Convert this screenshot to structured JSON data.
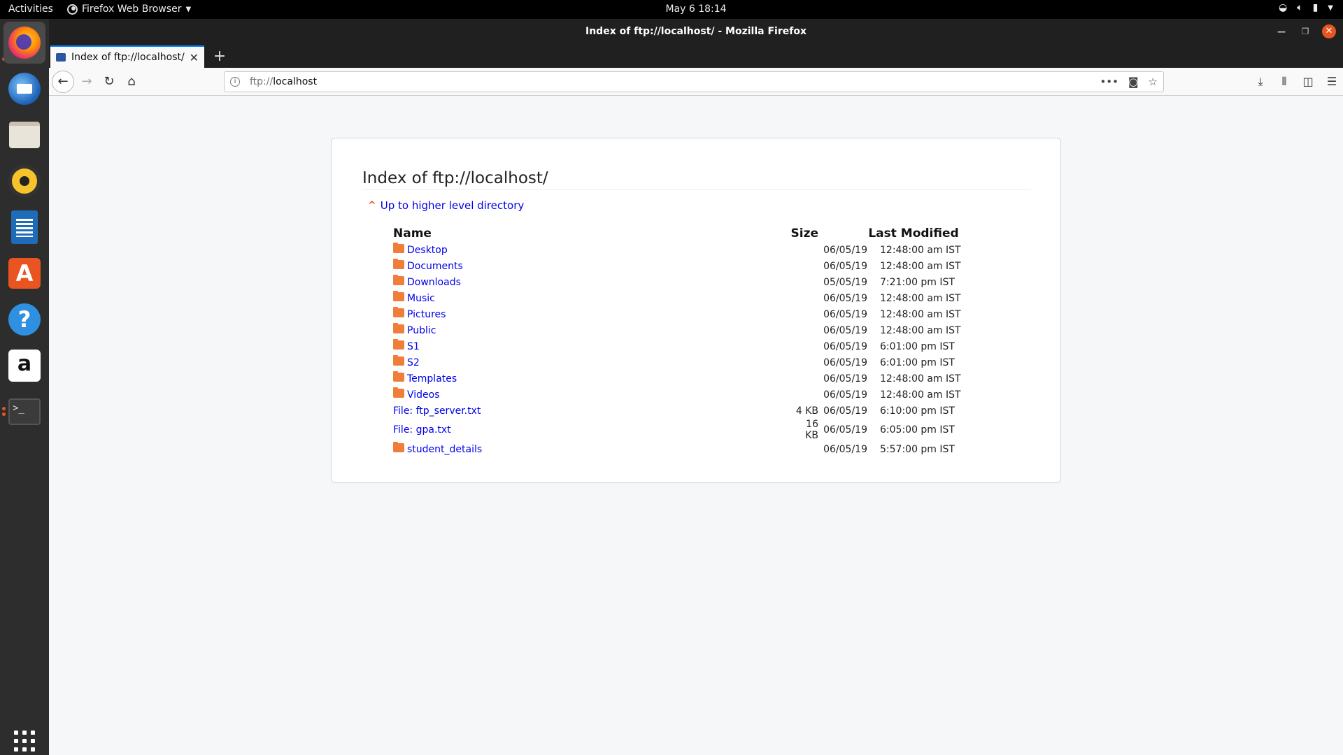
{
  "topbar": {
    "activities": "Activities",
    "app_menu": "Firefox Web Browser",
    "clock": "May 6  18:14"
  },
  "window": {
    "title": "Index of ftp://localhost/ - Mozilla Firefox"
  },
  "tab": {
    "title": "Index of ftp://localhost/"
  },
  "urlbar": {
    "scheme": "ftp://",
    "host": "localhost"
  },
  "page": {
    "heading": "Index of ftp://localhost/",
    "up_link": "Up to higher level directory",
    "columns": {
      "name": "Name",
      "size": "Size",
      "modified": "Last Modified"
    },
    "entries": [
      {
        "name": "Desktop",
        "size": "",
        "date": "06/05/19",
        "time": "12:48:00 am IST"
      },
      {
        "name": "Documents",
        "size": "",
        "date": "06/05/19",
        "time": "12:48:00 am IST"
      },
      {
        "name": "Downloads",
        "size": "",
        "date": "05/05/19",
        "time": "7:21:00 pm IST"
      },
      {
        "name": "Music",
        "size": "",
        "date": "06/05/19",
        "time": "12:48:00 am IST"
      },
      {
        "name": "Pictures",
        "size": "",
        "date": "06/05/19",
        "time": "12:48:00 am IST"
      },
      {
        "name": "Public",
        "size": "",
        "date": "06/05/19",
        "time": "12:48:00 am IST"
      },
      {
        "name": "S1",
        "size": "",
        "date": "06/05/19",
        "time": "6:01:00 pm IST"
      },
      {
        "name": "S2",
        "size": "",
        "date": "06/05/19",
        "time": "6:01:00 pm IST"
      },
      {
        "name": "Templates",
        "size": "",
        "date": "06/05/19",
        "time": "12:48:00 am IST"
      },
      {
        "name": "Videos",
        "size": "",
        "date": "06/05/19",
        "time": "12:48:00 am IST"
      },
      {
        "name": "File: ftp_server.txt",
        "size": "4 KB",
        "date": "06/05/19",
        "time": "6:10:00 pm IST"
      },
      {
        "name": "File: gpa.txt",
        "size": "16 KB",
        "date": "06/05/19",
        "time": "6:05:00 pm IST"
      },
      {
        "name": "student_details",
        "size": "",
        "date": "06/05/19",
        "time": "5:57:00 pm IST"
      }
    ]
  },
  "colors": {
    "accent": "#0a84ff",
    "link": "#0000ee",
    "folder": "#f07d3a",
    "ubuntu_orange": "#e95420"
  }
}
